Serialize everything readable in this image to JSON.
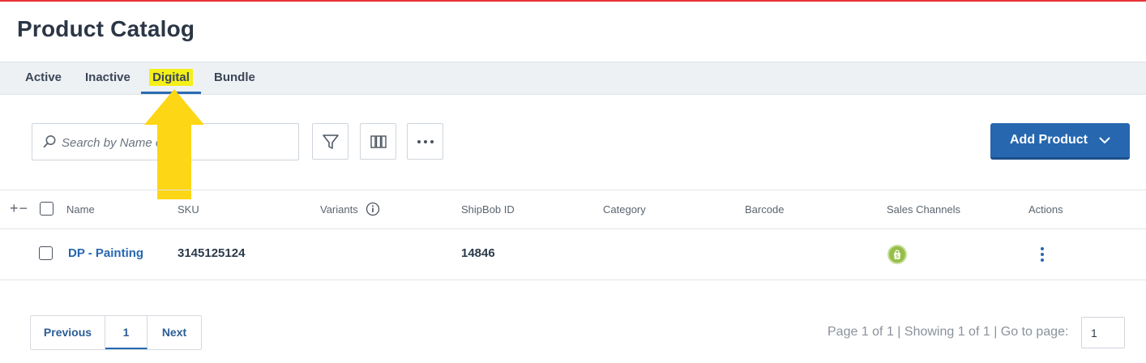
{
  "page": {
    "title": "Product Catalog"
  },
  "tabs": [
    {
      "label": "Active"
    },
    {
      "label": "Inactive"
    },
    {
      "label": "Digital"
    },
    {
      "label": "Bundle"
    }
  ],
  "active_tab": "Digital",
  "toolbar": {
    "search_placeholder": "Search by Name or ID",
    "filter_icon": "filter-icon",
    "columns_icon": "columns-icon",
    "more_icon": "more-horizontal-icon",
    "add_product_label": "Add Product"
  },
  "table": {
    "columns": [
      "Name",
      "SKU",
      "Variants",
      "ShipBob ID",
      "Category",
      "Barcode",
      "Sales Channels",
      "Actions"
    ],
    "rows": [
      {
        "name": "DP - Painting",
        "sku": "3145125124",
        "variants": "",
        "shipbob_id": "14846",
        "category": "",
        "barcode": "",
        "sales_channel_icon": "shopify-bag-icon",
        "actions_icon": "kebab-menu-icon"
      }
    ]
  },
  "pagination": {
    "previous_label": "Previous",
    "current_page": "1",
    "next_label": "Next",
    "summary": "Page 1 of 1 | Showing 1 of 1 | Go to page:",
    "goto_value": "1"
  },
  "colors": {
    "accent_blue": "#2667b0",
    "highlight_yellow": "#f5ef1a",
    "arrow_yellow": "#fdd615",
    "top_line_red": "#e8333a",
    "shopify_green": "#95bf47"
  },
  "annotation": {
    "arrow_icon": "yellow-up-arrow-icon"
  }
}
